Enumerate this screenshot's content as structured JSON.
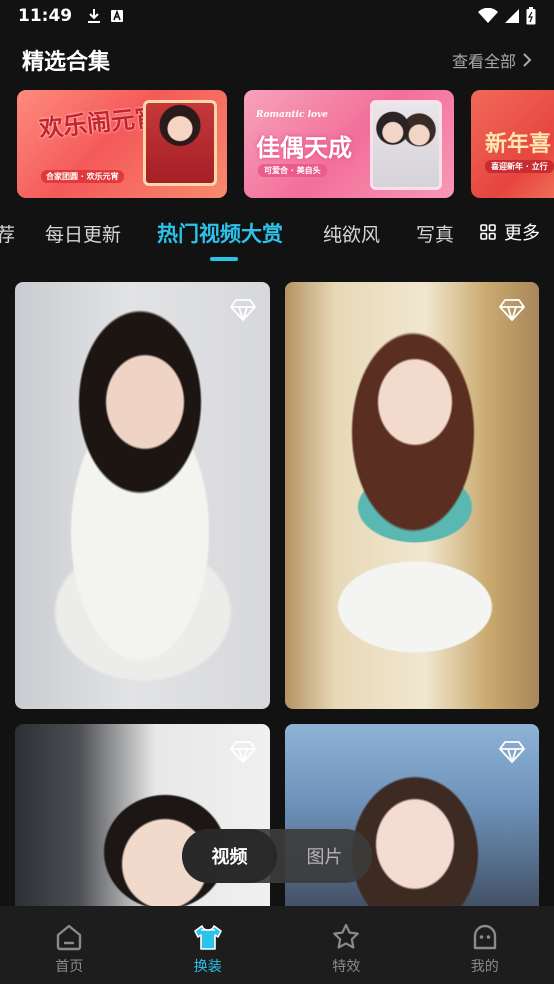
{
  "status_bar": {
    "time": "11:49"
  },
  "featured": {
    "title": "精选合集",
    "view_all": "查看全部"
  },
  "banners": [
    {
      "title": "欢乐闹元宵",
      "subtitle": "合家团圆 · 欢乐元宵"
    },
    {
      "tag": "Romantic love",
      "title": "佳偶天成",
      "subtitle": "可爱合 · 美自头"
    },
    {
      "title": "新年喜",
      "subtitle": "喜迎新年 · 立行"
    }
  ],
  "tabs": {
    "items": [
      "荐",
      "每日更新",
      "热门视频大赏",
      "纯欲风",
      "写真"
    ],
    "active_index": 2,
    "more_label": "更多"
  },
  "toggle": {
    "video": "视频",
    "image": "图片",
    "active": "视频"
  },
  "bottom_nav": [
    {
      "label": "首页",
      "icon": "home-icon"
    },
    {
      "label": "换装",
      "icon": "shirt-icon",
      "active": true
    },
    {
      "label": "特效",
      "icon": "star-icon"
    },
    {
      "label": "我的",
      "icon": "profile-icon"
    }
  ],
  "colors": {
    "accent": "#2cc2ea",
    "background": "#121212",
    "nav_background": "#1d1d1d"
  }
}
